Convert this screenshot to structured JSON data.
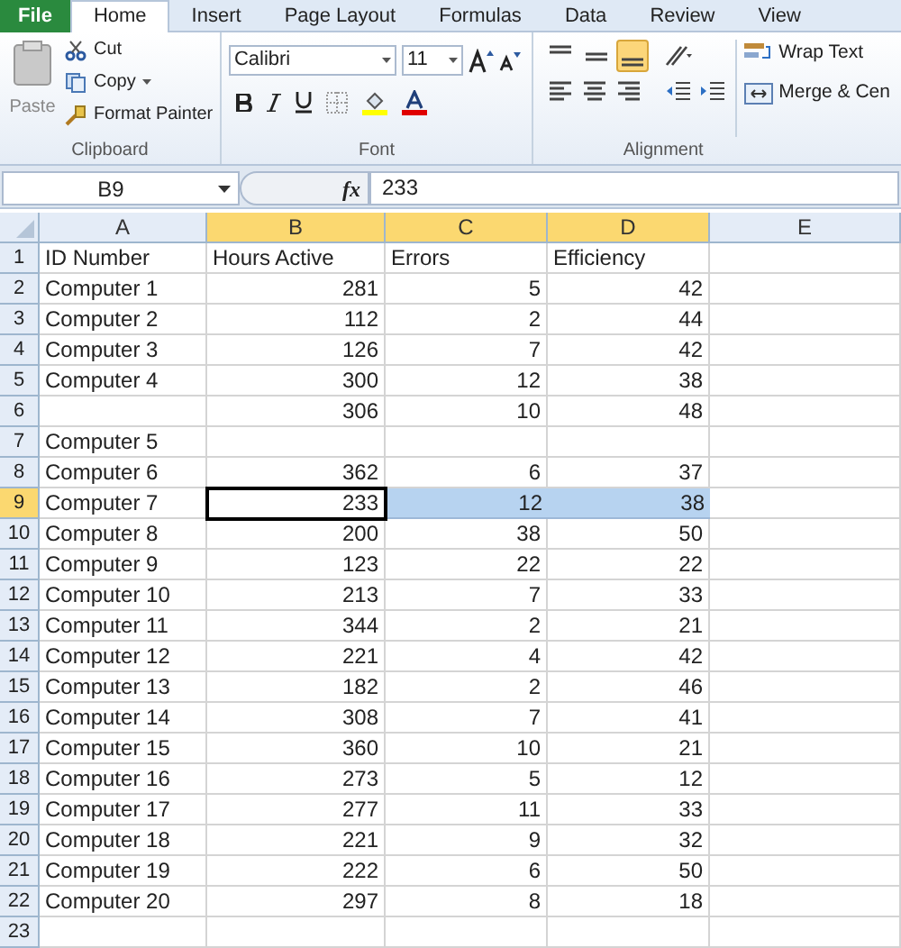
{
  "ribbon_tabs": [
    {
      "label": "File",
      "kind": "file",
      "selected": false
    },
    {
      "label": "Home",
      "kind": "tab",
      "selected": true
    },
    {
      "label": "Insert",
      "kind": "tab",
      "selected": false
    },
    {
      "label": "Page Layout",
      "kind": "tab",
      "selected": false
    },
    {
      "label": "Formulas",
      "kind": "tab",
      "selected": false
    },
    {
      "label": "Data",
      "kind": "tab",
      "selected": false
    },
    {
      "label": "Review",
      "kind": "tab",
      "selected": false
    },
    {
      "label": "View",
      "kind": "tab",
      "selected": false
    }
  ],
  "clipboard": {
    "label": "Clipboard",
    "paste": "Paste",
    "cut": "Cut",
    "copy": "Copy",
    "format_painter": "Format Painter"
  },
  "font": {
    "label": "Font",
    "font_name": "Calibri",
    "font_size": "11"
  },
  "alignment": {
    "label": "Alignment",
    "vertical_buttons": [
      {
        "kind": "top",
        "selected": false
      },
      {
        "kind": "middle",
        "selected": false
      },
      {
        "kind": "bottom",
        "selected": true
      }
    ],
    "wrap_text": "Wrap Text",
    "merge": "Merge & Cen"
  },
  "formula_bar": {
    "name_box": "B9",
    "fx": "fx",
    "value": "233"
  },
  "columns": [
    {
      "label": "A",
      "kind": "text",
      "selected": false,
      "active": false
    },
    {
      "label": "B",
      "kind": "number",
      "selected": true,
      "active": true
    },
    {
      "label": "C",
      "kind": "number",
      "selected": true,
      "active": false
    },
    {
      "label": "D",
      "kind": "number",
      "selected": true,
      "active": false
    },
    {
      "label": "E",
      "kind": "number",
      "selected": false,
      "active": false
    }
  ],
  "rows": [
    {
      "header": "1",
      "kind": "labels",
      "selected": false,
      "cells": [
        "ID Number",
        "Hours Active",
        "Errors",
        "Efficiency",
        ""
      ]
    },
    {
      "header": "2",
      "kind": "data",
      "selected": false,
      "cells": [
        "Computer 1",
        "281",
        "5",
        "42",
        ""
      ]
    },
    {
      "header": "3",
      "kind": "data",
      "selected": false,
      "cells": [
        "Computer 2",
        "112",
        "2",
        "44",
        ""
      ]
    },
    {
      "header": "4",
      "kind": "data",
      "selected": false,
      "cells": [
        "Computer 3",
        "126",
        "7",
        "42",
        ""
      ]
    },
    {
      "header": "5",
      "kind": "data",
      "selected": false,
      "cells": [
        "Computer 4",
        "300",
        "12",
        "38",
        ""
      ]
    },
    {
      "header": "6",
      "kind": "data",
      "selected": false,
      "cells": [
        "",
        "306",
        "10",
        "48",
        ""
      ]
    },
    {
      "header": "7",
      "kind": "data",
      "selected": false,
      "cells": [
        "Computer 5",
        "",
        "",
        "",
        ""
      ]
    },
    {
      "header": "8",
      "kind": "data",
      "selected": false,
      "cells": [
        "Computer 6",
        "362",
        "6",
        "37",
        ""
      ]
    },
    {
      "header": "9",
      "kind": "data",
      "selected": true,
      "cells": [
        "Computer 7",
        "233",
        "12",
        "38",
        ""
      ]
    },
    {
      "header": "10",
      "kind": "data",
      "selected": false,
      "cells": [
        "Computer 8",
        "200",
        "38",
        "50",
        ""
      ]
    },
    {
      "header": "11",
      "kind": "data",
      "selected": false,
      "cells": [
        "Computer 9",
        "123",
        "22",
        "22",
        ""
      ]
    },
    {
      "header": "12",
      "kind": "data",
      "selected": false,
      "cells": [
        "Computer 10",
        "213",
        "7",
        "33",
        ""
      ]
    },
    {
      "header": "13",
      "kind": "data",
      "selected": false,
      "cells": [
        "Computer 11",
        "344",
        "2",
        "21",
        ""
      ]
    },
    {
      "header": "14",
      "kind": "data",
      "selected": false,
      "cells": [
        "Computer 12",
        "221",
        "4",
        "42",
        ""
      ]
    },
    {
      "header": "15",
      "kind": "data",
      "selected": false,
      "cells": [
        "Computer 13",
        "182",
        "2",
        "46",
        ""
      ]
    },
    {
      "header": "16",
      "kind": "data",
      "selected": false,
      "cells": [
        "Computer 14",
        "308",
        "7",
        "41",
        ""
      ]
    },
    {
      "header": "17",
      "kind": "data",
      "selected": false,
      "cells": [
        "Computer 15",
        "360",
        "10",
        "21",
        ""
      ]
    },
    {
      "header": "18",
      "kind": "data",
      "selected": false,
      "cells": [
        "Computer 16",
        "273",
        "5",
        "12",
        ""
      ]
    },
    {
      "header": "19",
      "kind": "data",
      "selected": false,
      "cells": [
        "Computer 17",
        "277",
        "11",
        "33",
        ""
      ]
    },
    {
      "header": "20",
      "kind": "data",
      "selected": false,
      "cells": [
        "Computer 18",
        "221",
        "9",
        "32",
        ""
      ]
    },
    {
      "header": "21",
      "kind": "data",
      "selected": false,
      "cells": [
        "Computer 19",
        "222",
        "6",
        "50",
        ""
      ]
    },
    {
      "header": "22",
      "kind": "data",
      "selected": false,
      "cells": [
        "Computer 20",
        "297",
        "8",
        "18",
        ""
      ]
    },
    {
      "header": "23",
      "kind": "data",
      "selected": false,
      "cells": [
        "",
        "",
        "",
        "",
        ""
      ]
    }
  ]
}
